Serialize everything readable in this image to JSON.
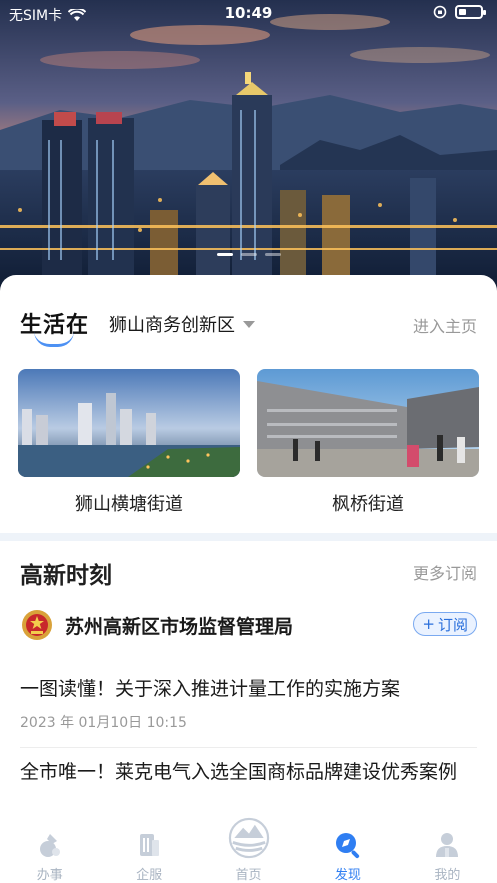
{
  "status_bar": {
    "carrier": "无SIM卡",
    "time": "10:49",
    "battery_level": 0.35
  },
  "banner": {
    "slide_count": 3,
    "active_slide": 1
  },
  "life": {
    "title": "生活在",
    "district": "狮山商务创新区",
    "enter_home": "进入主页",
    "streets": [
      {
        "name": "狮山横塘街道",
        "icon": "city-skyline-photo"
      },
      {
        "name": "枫桥街道",
        "icon": "plaza-building-photo"
      }
    ]
  },
  "news": {
    "title": "高新时刻",
    "more_label": "更多订阅",
    "org_name": "苏州高新区市场监督管理局",
    "subscribe_label": "订阅",
    "articles": [
      {
        "title": "一图读懂！关于深入推进计量工作的实施方案",
        "date": "2023 年 01月10日 10:15"
      },
      {
        "title": "全市唯一！莱克电气入选全国商标品牌建设优秀案例"
      }
    ]
  },
  "tabs": [
    {
      "label": "办事",
      "icon": "service-icon"
    },
    {
      "label": "企服",
      "icon": "enterprise-icon"
    },
    {
      "label": "首页",
      "icon": "home-logo-icon"
    },
    {
      "label": "发现",
      "icon": "discover-icon",
      "active": true
    },
    {
      "label": "我的",
      "icon": "profile-icon"
    }
  ],
  "colors": {
    "accent": "#2f7ef2",
    "tab_inactive": "#a9b4c2"
  }
}
